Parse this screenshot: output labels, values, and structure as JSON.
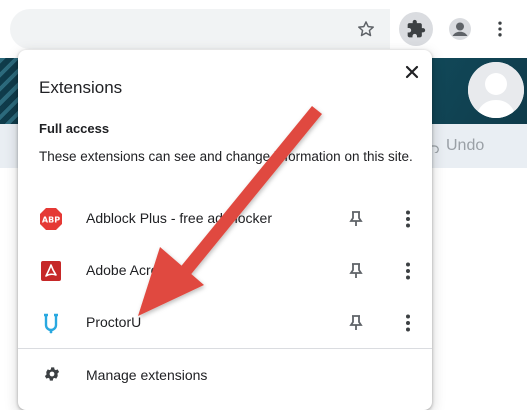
{
  "popup": {
    "title": "Extensions",
    "section_title": "Full access",
    "section_description": "These extensions can see and change information on this site.",
    "extensions": [
      {
        "name": "Adblock Plus - free ad blocker",
        "icon": "adblock-plus-icon",
        "icon_text": "ABP",
        "icon_color": "#e53935"
      },
      {
        "name": "Adobe Acrobat",
        "icon": "adobe-acrobat-icon",
        "icon_color": "#c62828"
      },
      {
        "name": "ProctorU",
        "icon": "proctoru-icon",
        "icon_color": "#29a8e0"
      }
    ],
    "manage_label": "Manage extensions"
  },
  "page": {
    "undo_label": "Undo"
  },
  "colors": {
    "arrow": "#e04a3f",
    "banner": "#135466",
    "toolbar_active": "#dadce0"
  }
}
